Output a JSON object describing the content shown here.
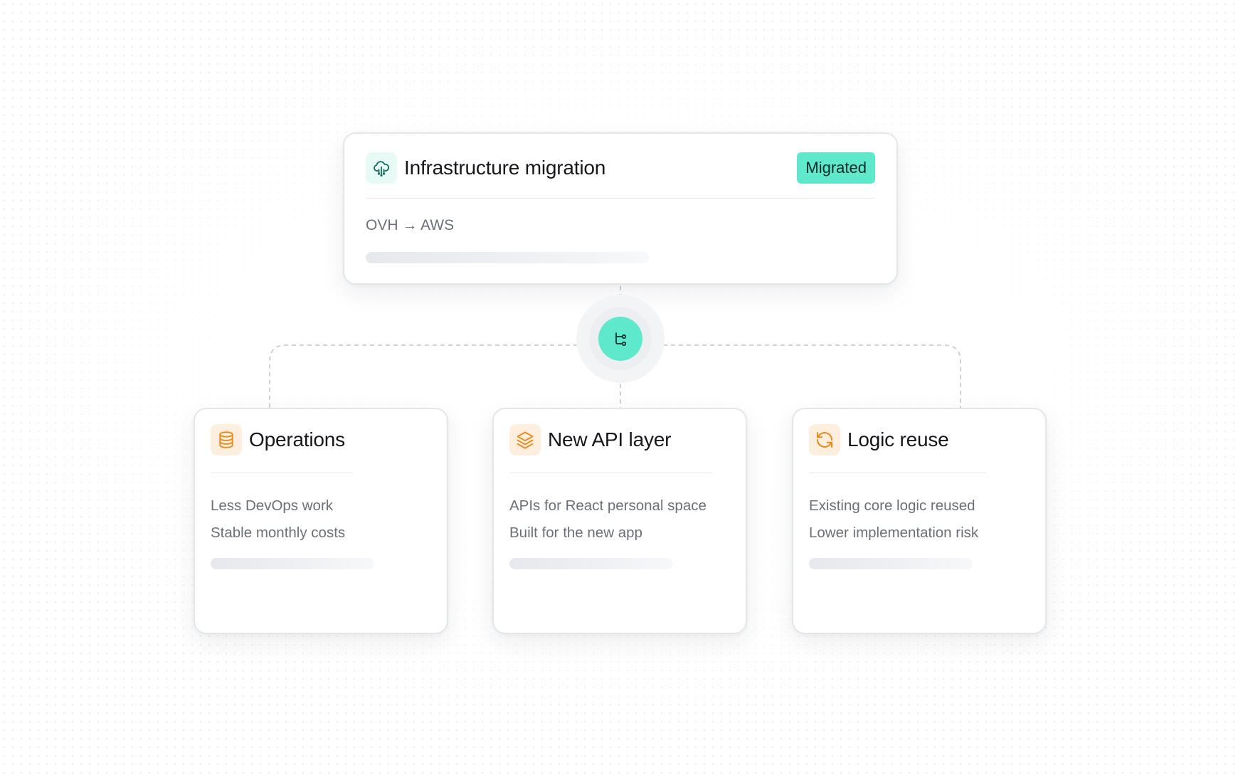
{
  "colors": {
    "accent": "#5ee8cc",
    "icon_teal": "#1a6e5f",
    "icon_orange": "#e8891a",
    "icon_orange_bg": "#fdeedd"
  },
  "source": {
    "icon": "cloud-network-icon",
    "title": "Infrastructure migration",
    "badge": "Migrated",
    "subtitle": "OVH → AWS"
  },
  "hub": {
    "icon": "branch-icon"
  },
  "outcomes": [
    {
      "icon": "database-icon",
      "title": "Operations",
      "lines": [
        "Less DevOps work",
        "Stable monthly costs"
      ]
    },
    {
      "icon": "layers-icon",
      "title": "New API layer",
      "lines": [
        "APIs for React personal space",
        "Built for the new app"
      ]
    },
    {
      "icon": "refresh-icon",
      "title": "Logic reuse",
      "lines": [
        "Existing core logic reused",
        "Lower implementation risk"
      ]
    }
  ]
}
